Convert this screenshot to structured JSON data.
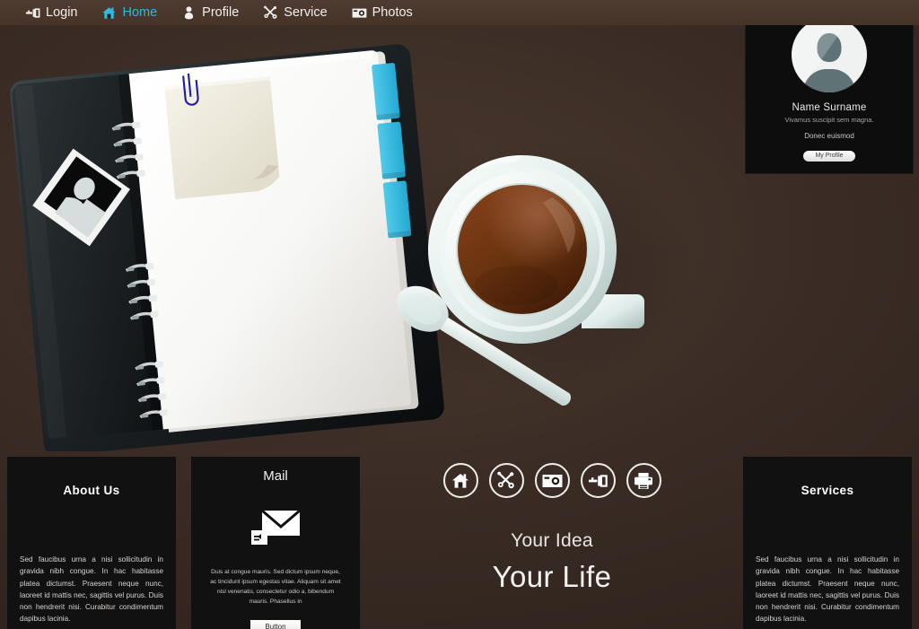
{
  "theme": {
    "background": "#3a2c25",
    "topbar_bg": "#473528",
    "accent": "#2fb8e0",
    "panel_bg": "#111111",
    "text_light": "#f2efec"
  },
  "topnav": {
    "items": [
      {
        "label": "Login",
        "icon": "key-icon",
        "active": false
      },
      {
        "label": "Home",
        "icon": "home-icon",
        "active": true
      },
      {
        "label": "Profile",
        "icon": "person-icon",
        "active": false
      },
      {
        "label": "Service",
        "icon": "wrench-icon",
        "active": false
      },
      {
        "label": "Photos",
        "icon": "camera-icon",
        "active": false
      }
    ]
  },
  "profile_card": {
    "avatar_icon": "person-avatar-icon",
    "name": "Name Surname",
    "subtitle": "Vivamus suscipit sem magna.",
    "subtitle2": "Donec euismod",
    "button_label": "My Profile"
  },
  "hero": {
    "description": "Top-down photo of an open black spiral notebook with blank white pages, a cream sticky note held by a blue paperclip, three cyan page tabs, a polaroid-style photo on the cover, and a white cup of coffee on a saucer with a spoon.",
    "colors": {
      "notebook_cover": "#141414",
      "page_white": "#fafafa",
      "sticky_note": "#f0ece0",
      "paperclip": "#1b1ba8",
      "tab_cyan": "#37bce4",
      "coffee": "#6b3416",
      "cup_white": "#e6efec"
    }
  },
  "panels": {
    "about": {
      "title": "About Us",
      "body": "Sed faucibus urna a nisi sollicitudin in gravida nibh congue. In hac habitasse platea dictumst. Praesent neque nunc, laoreet id mattis nec, sagittis vel purus. Duis non hendrerit nisi. Curabitur condimentum dapibus lacinia."
    },
    "mail": {
      "title": "Mail",
      "icon": "envelope-icon",
      "body": "Duis at congue mauris. Sed dictum ipsum neque, ac tincidunt ipsum egestas vitae. Aliquam sit amet nisl venenatis, consectetur odio a, bibendum mauris. Phasellus in",
      "button_label": "Button"
    },
    "services": {
      "title": "Services",
      "body": "Sed faucibus urna a nisi sollicitudin in gravida nibh congue. In hac habitasse platea dictumst. Praesent neque nunc, laoreet id mattis nec, sagittis vel purus. Duis non hendrerit nisi. Curabitur condimentum dapibus lacinia."
    }
  },
  "center": {
    "icons": [
      {
        "name": "home-icon"
      },
      {
        "name": "wrench-icon"
      },
      {
        "name": "camera-icon"
      },
      {
        "name": "key-icon"
      },
      {
        "name": "printer-icon"
      }
    ],
    "tagline1": "Your Idea",
    "tagline2": "Your Life"
  }
}
